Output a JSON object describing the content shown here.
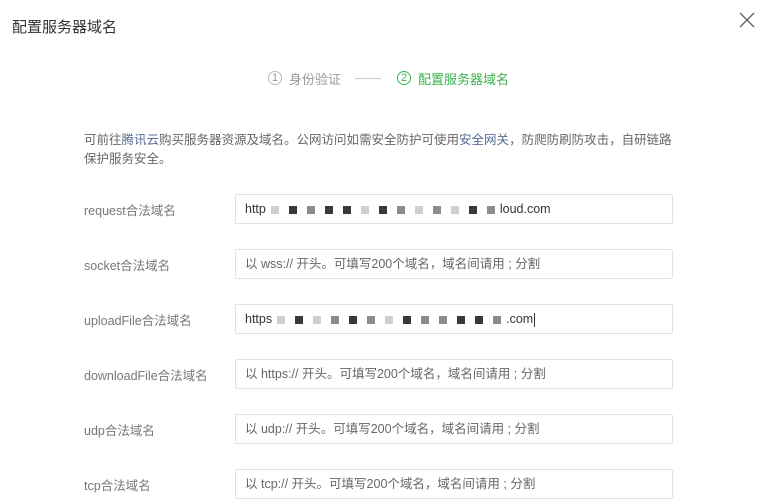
{
  "dialog": {
    "title": "配置服务器域名"
  },
  "steps": [
    {
      "num": "1",
      "label": "身份验证",
      "active": false
    },
    {
      "num": "2",
      "label": "配置服务器域名",
      "active": true
    }
  ],
  "description": {
    "prefix": "可前往",
    "link1": "腾讯云",
    "middle": "购买服务器资源及域名。公网访问如需安全防护可使用",
    "link2": "安全网关",
    "suffix": "，防爬防刷防攻击，自研链路保护服务安全。"
  },
  "fields": [
    {
      "label": "request合法域名",
      "value_prefix": "http",
      "value_suffix": "loud.com",
      "placeholder": ""
    },
    {
      "label": "socket合法域名",
      "value_prefix": "",
      "value_suffix": "",
      "placeholder": "以 wss:// 开头。可填写200个域名，域名间请用 ; 分割"
    },
    {
      "label": "uploadFile合法域名",
      "value_prefix": "https",
      "value_suffix": ".com",
      "placeholder": ""
    },
    {
      "label": "downloadFile合法域名",
      "value_prefix": "",
      "value_suffix": "",
      "placeholder": "以 https:// 开头。可填写200个域名，域名间请用 ; 分割"
    },
    {
      "label": "udp合法域名",
      "value_prefix": "",
      "value_suffix": "",
      "placeholder": "以 udp:// 开头。可填写200个域名，域名间请用 ; 分割"
    },
    {
      "label": "tcp合法域名",
      "value_prefix": "",
      "value_suffix": "",
      "placeholder": "以 tcp:// 开头。可填写200个域名，域名间请用 ; 分割"
    }
  ],
  "colors": {
    "accent_green": "#3bb14b",
    "link_blue": "#576b95"
  },
  "icons": {
    "close": "close-icon"
  }
}
